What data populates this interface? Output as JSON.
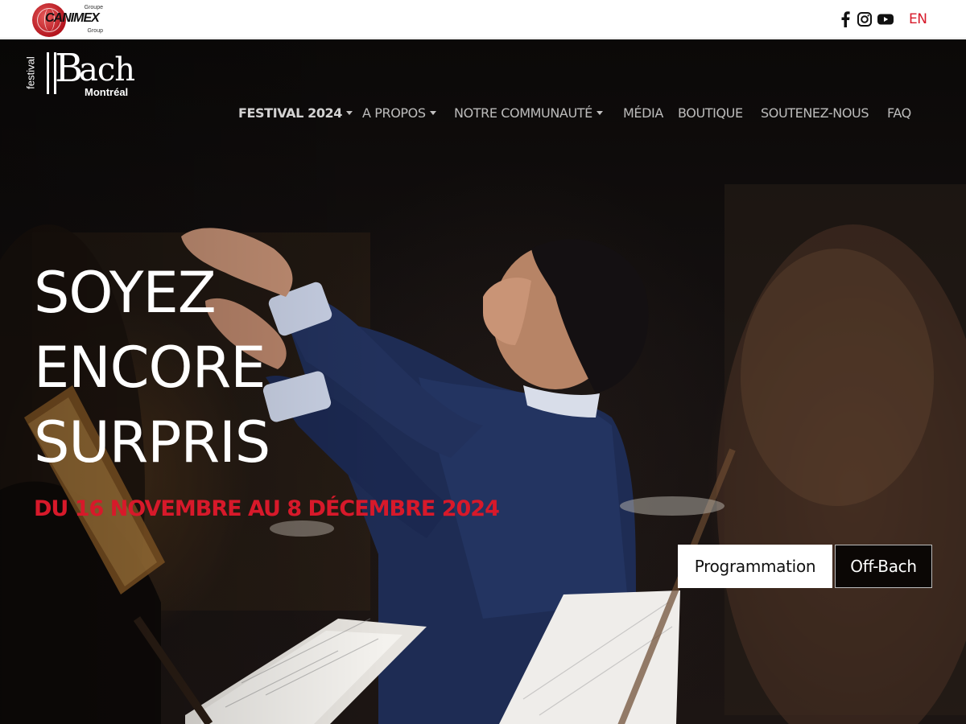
{
  "sponsor": {
    "top_text": "Groupe",
    "name": "CANIMEX",
    "bottom_text": "Group"
  },
  "social": {
    "icons": [
      "facebook-icon",
      "instagram-icon",
      "youtube-icon"
    ]
  },
  "language": {
    "label": "EN"
  },
  "logo": {
    "festival": "festival",
    "name_b": "B",
    "name_rest": "ach",
    "city": "Montréal"
  },
  "nav": {
    "items": [
      {
        "label": "FESTIVAL 2024",
        "dropdown": true
      },
      {
        "label": "A PROPOS",
        "dropdown": true
      },
      {
        "label": "NOTRE COMMUNAUTÉ",
        "dropdown": true
      },
      {
        "label": "MÉDIA",
        "dropdown": false
      },
      {
        "label": "BOUTIQUE",
        "dropdown": false
      },
      {
        "label": "SOUTENEZ-NOUS",
        "dropdown": false
      },
      {
        "label": "FAQ",
        "dropdown": false
      }
    ]
  },
  "hero": {
    "headline": [
      "SOYEZ",
      "ENCORE",
      "SURPRIS"
    ],
    "dates": "DU 16 NOVEMBRE AU 8 DÉCEMBRE 2024",
    "buttons": {
      "primary": "Programmation",
      "secondary": "Off-Bach"
    }
  },
  "colors": {
    "accent_red": "#d7192a",
    "hero_dark": "#141010",
    "white": "#ffffff"
  }
}
